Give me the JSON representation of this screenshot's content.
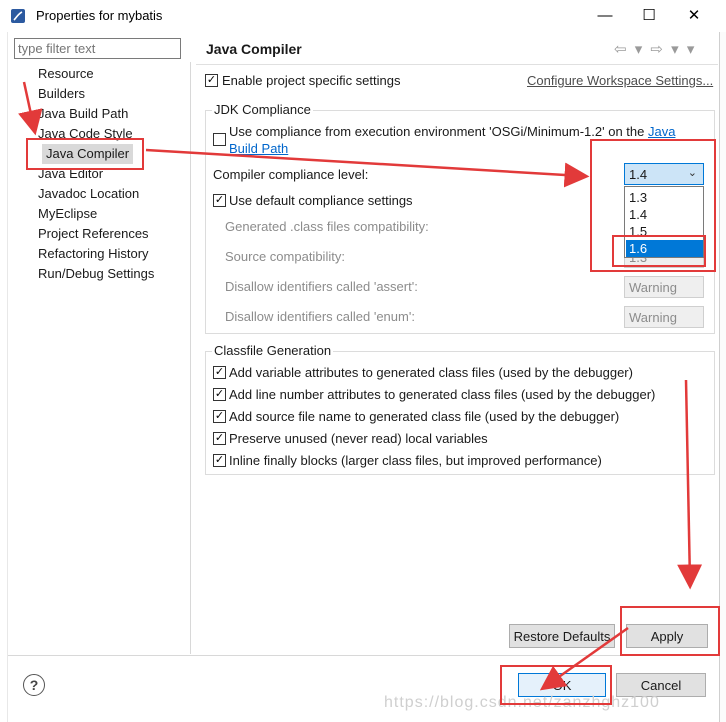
{
  "window": {
    "title": "Properties for mybatis",
    "min": "—",
    "max": "☐",
    "close": "✕"
  },
  "filter": {
    "placeholder": "type filter text"
  },
  "tree": {
    "items": [
      {
        "label": "Resource"
      },
      {
        "label": "Builders"
      },
      {
        "label": "Java Build Path"
      },
      {
        "label": "Java Code Style"
      },
      {
        "label": "Java Compiler"
      },
      {
        "label": "Java Editor"
      },
      {
        "label": "Javadoc Location"
      },
      {
        "label": "MyEclipse"
      },
      {
        "label": "Project References"
      },
      {
        "label": "Refactoring History"
      },
      {
        "label": "Run/Debug Settings"
      }
    ],
    "selected_index": 4
  },
  "page": {
    "title": "Java Compiler",
    "nav": "⇦ ▾ ⇨ ▾ ▾",
    "enable_specific": "Enable project specific settings",
    "configure_link": "Configure Workspace Settings..."
  },
  "jdk": {
    "group_title": "JDK Compliance",
    "use_env_prefix": "Use compliance from execution environment 'OSGi/Minimum-1.2' on the ",
    "use_env_link1": "Java",
    "use_env_link2": "Build Path",
    "compliance_label": "Compiler compliance level:",
    "compliance_value": "1.4",
    "compliance_options": [
      "1.3",
      "1.4",
      "1.5",
      "1.6"
    ],
    "highlighted_option": "1.6",
    "use_default": "Use default compliance settings",
    "generated_label": "Generated .class files compatibility:",
    "source_label": "Source compatibility:",
    "source_value": "1.3",
    "assert_label": "Disallow identifiers called 'assert':",
    "assert_value": "Warning",
    "enum_label": "Disallow identifiers called 'enum':",
    "enum_value": "Warning"
  },
  "classfile": {
    "group_title": "Classfile Generation",
    "options": [
      "Add variable attributes to generated class files (used by the debugger)",
      "Add line number attributes to generated class files (used by the debugger)",
      "Add source file name to generated class file (used by the debugger)",
      "Preserve unused (never read) local variables",
      "Inline finally blocks (larger class files, but improved performance)"
    ]
  },
  "buttons": {
    "restore": "Restore Defaults",
    "apply": "Apply",
    "ok": "OK",
    "cancel": "Cancel",
    "help": "?"
  },
  "watermark": "https://blog.csdn.net/zanzhghz100",
  "colors": {
    "annotation": "#e23a3a",
    "selection": "#0078d7",
    "link": "#0066cc"
  }
}
